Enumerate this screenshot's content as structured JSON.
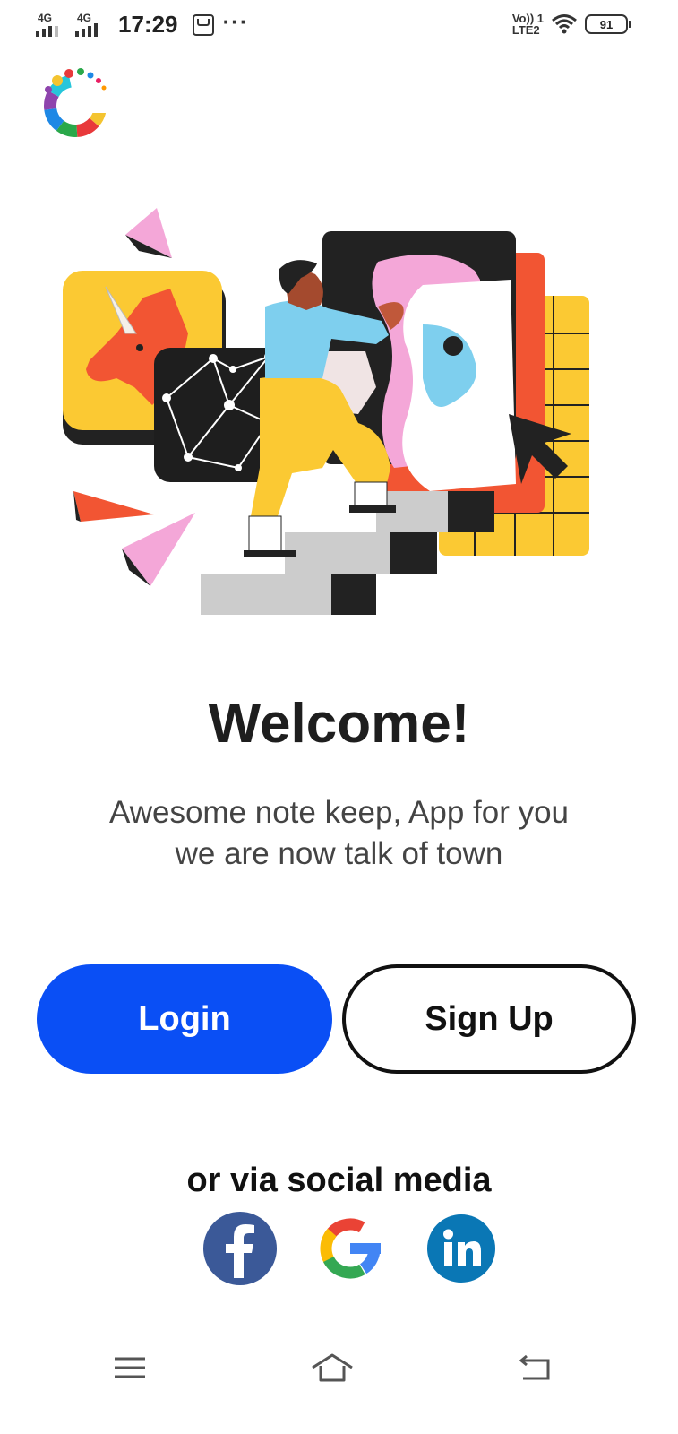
{
  "status_bar": {
    "network_1": "4G",
    "network_2": "4G",
    "time": "17:29",
    "overflow": "···",
    "volte_line1": "Vo)) 1",
    "volte_line2": "LTE2",
    "battery": "91",
    "icons": [
      "signal-icon",
      "message-icon",
      "wifi-icon",
      "battery-icon"
    ]
  },
  "logo_icon": "app-logo-icon",
  "illustration_icon": "woman-climbing-stairs-illustration",
  "welcome": {
    "title": "Welcome!",
    "subtitle_line1": "Awesome note keep, App for you",
    "subtitle_line2": "we are now talk of town"
  },
  "actions": {
    "login_label": "Login",
    "signup_label": "Sign Up",
    "login_color": "#0a4ff5"
  },
  "social": {
    "label": "or via social media",
    "providers": [
      "facebook-icon",
      "google-icon",
      "linkedin-icon"
    ],
    "colors": {
      "facebook": "#3b5998",
      "linkedin": "#0a77b5"
    }
  },
  "nav": {
    "icons": [
      "menu-icon",
      "home-icon",
      "back-icon"
    ]
  }
}
